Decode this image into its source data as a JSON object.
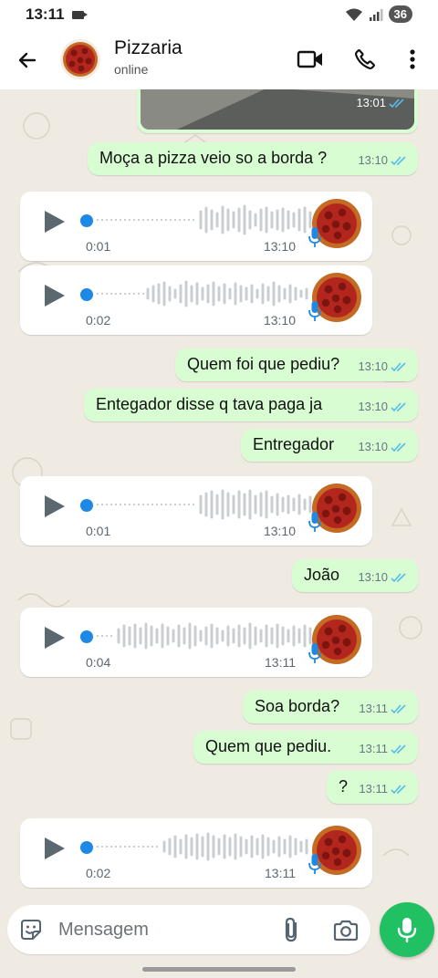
{
  "status_bar": {
    "time": "13:11",
    "battery": "36",
    "icons": [
      "screen-record-icon",
      "wifi-icon",
      "signal-icon"
    ]
  },
  "header": {
    "contact_name": "Pizzaria",
    "contact_status": "online",
    "icons": [
      "back-arrow-icon",
      "video-call-icon",
      "voice-call-icon",
      "more-options-icon"
    ]
  },
  "messages": [
    {
      "type": "image",
      "direction": "out",
      "time": "13:01",
      "status": "read"
    },
    {
      "type": "text",
      "direction": "out",
      "text": "Moça a pizza veio so a borda ?",
      "time": "13:10",
      "status": "read"
    },
    {
      "type": "voice",
      "direction": "in",
      "duration": "0:01",
      "time": "13:10"
    },
    {
      "type": "voice",
      "direction": "in",
      "duration": "0:02",
      "time": "13:10"
    },
    {
      "type": "text",
      "direction": "out",
      "text": "Quem foi que pediu?",
      "time": "13:10",
      "status": "read"
    },
    {
      "type": "text",
      "direction": "out",
      "text": "Entegador disse q tava paga ja",
      "time": "13:10",
      "status": "read"
    },
    {
      "type": "text",
      "direction": "out",
      "text": "Entregador",
      "time": "13:10",
      "status": "read"
    },
    {
      "type": "voice",
      "direction": "in",
      "duration": "0:01",
      "time": "13:10"
    },
    {
      "type": "text",
      "direction": "out",
      "text": "João",
      "time": "13:10",
      "status": "read"
    },
    {
      "type": "voice",
      "direction": "in",
      "duration": "0:04",
      "time": "13:11"
    },
    {
      "type": "text",
      "direction": "out",
      "text": "Soa borda?",
      "time": "13:11",
      "status": "read"
    },
    {
      "type": "text",
      "direction": "out",
      "text": "Quem que pediu.",
      "time": "13:11",
      "status": "read"
    },
    {
      "type": "text",
      "direction": "out",
      "text": "?",
      "time": "13:11",
      "status": "read"
    },
    {
      "type": "voice",
      "direction": "in",
      "duration": "0:02",
      "time": "13:11"
    }
  ],
  "composer": {
    "placeholder": "Mensagem",
    "icons": [
      "sticker-icon",
      "attach-icon",
      "camera-icon",
      "mic-icon"
    ]
  },
  "colors": {
    "outgoing_bubble": "#d9fdd3",
    "incoming_bubble": "#ffffff",
    "chat_background": "#efeae2",
    "accent_green": "#21c063",
    "read_ticks": "#53bdeb",
    "voice_dot": "#1e88e5"
  }
}
